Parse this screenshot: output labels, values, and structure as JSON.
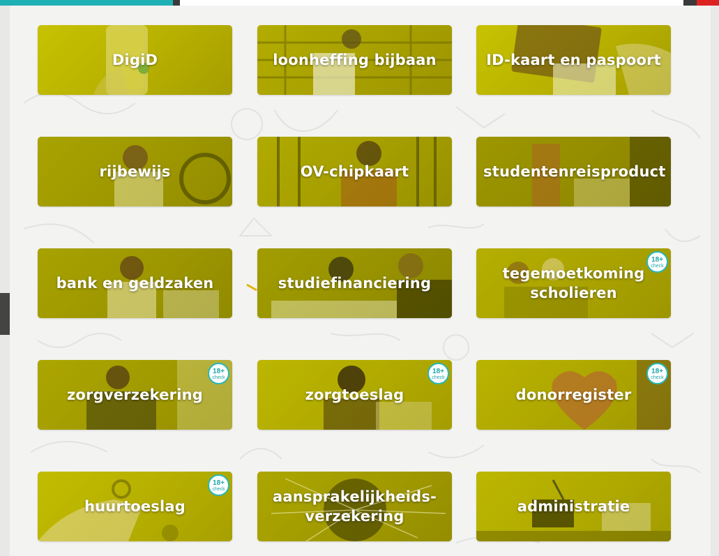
{
  "tiles": [
    {
      "label": "DigiD",
      "badge": false
    },
    {
      "label": "loonheffing bijbaan",
      "badge": false
    },
    {
      "label": "ID-kaart en paspoort",
      "badge": false
    },
    {
      "label": "rijbewijs",
      "badge": false
    },
    {
      "label": "OV-chipkaart",
      "badge": false
    },
    {
      "label": "studentenreisproduct",
      "badge": false
    },
    {
      "label": "bank en geldzaken",
      "badge": false
    },
    {
      "label": "studiefinanciering",
      "badge": false
    },
    {
      "label": "tegemoetkoming scholieren",
      "badge": true
    },
    {
      "label": "zorgverzekering",
      "badge": true
    },
    {
      "label": "zorgtoeslag",
      "badge": true
    },
    {
      "label": "donorregister",
      "badge": true
    },
    {
      "label": "huurtoeslag",
      "badge": true
    },
    {
      "label": "aansprakelijkheids-verzekering",
      "badge": false
    },
    {
      "label": "administratie",
      "badge": false
    }
  ],
  "badge": {
    "top": "18+",
    "bottom": "check"
  },
  "colors": {
    "tile": "#bcb600",
    "badge_ring": "#27b7b9",
    "panel_bg": "#f3f3f2"
  }
}
